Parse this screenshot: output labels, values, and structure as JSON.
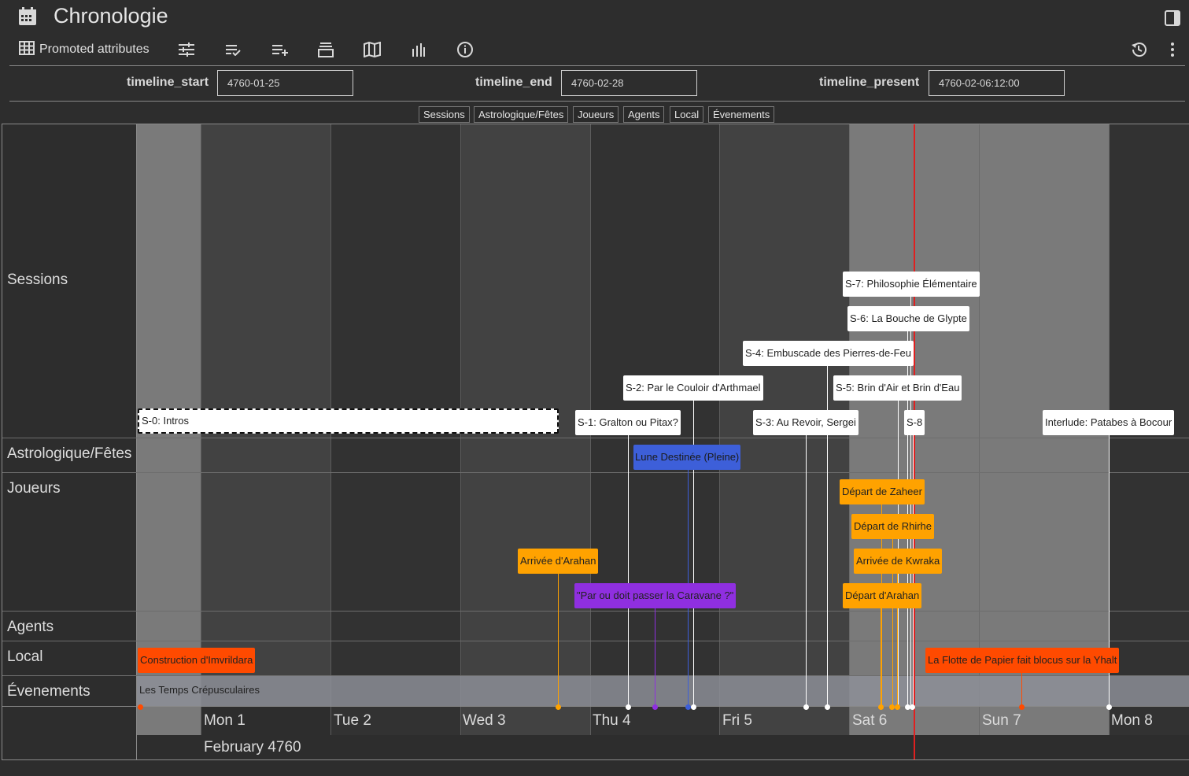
{
  "header": {
    "title": "Chronologie",
    "calendar_icon": "calendar-icon",
    "right_sidebar_icon": "sidebar-toggle-icon"
  },
  "toolbar": {
    "promoted_label": "Promoted attributes",
    "icons": [
      "grid-icon",
      "sliders-icon",
      "checklist-icon",
      "add-list-icon",
      "archive-icon",
      "map-icon",
      "chart-icon",
      "info-icon"
    ],
    "history_icon": "history-icon",
    "menu_icon": "more-vertical-icon"
  },
  "attributes": {
    "start_label": "timeline_start",
    "start_value": "4760-01-25",
    "end_label": "timeline_end",
    "end_value": "4760-02-28",
    "present_label": "timeline_present",
    "present_value": "4760-02-06:12:00"
  },
  "groups": [
    "Sessions",
    "Astrologique/Fêtes",
    "Joueurs",
    "Agents",
    "Local",
    "Évenements"
  ],
  "axis": {
    "days": [
      "Mon 1",
      "Tue 2",
      "Wed 3",
      "Thu 4",
      "Fri 5",
      "Sat 6",
      "Sun 7",
      "Mon 8"
    ],
    "month": "February 4760"
  },
  "colors": {
    "session": "#ffffff",
    "astro": "#3d5fd9",
    "player_orange": "#ffa200",
    "player_purple": "#8f2fe0",
    "local": "#ff4a00",
    "present_line": "#e02020",
    "event_band": "#8e9099"
  },
  "items": {
    "sessions": [
      {
        "label": "S-0: Intros"
      },
      {
        "label": "S-1: Gralton ou Pitax?"
      },
      {
        "label": "S-2: Par le Couloir d'Arthmael"
      },
      {
        "label": "S-3: Au Revoir, Sergei"
      },
      {
        "label": "S-4: Embuscade des Pierres-de-Feu"
      },
      {
        "label": "S-5: Brin d'Air et Brin d'Eau"
      },
      {
        "label": "S-6: La Bouche de Glypte"
      },
      {
        "label": "S-7: Philosophie Élémentaire"
      },
      {
        "label": "S-8"
      },
      {
        "label": "Interlude: Patabes à Bocour"
      }
    ],
    "astro": [
      {
        "label": "Lune Destinée (Pleine)"
      }
    ],
    "players": [
      {
        "label": "Arrivée d'Arahan"
      },
      {
        "label": "\"Par ou doit passer la Caravane ?\""
      },
      {
        "label": "Départ de Zaheer"
      },
      {
        "label": "Départ de Rhirhe"
      },
      {
        "label": "Arrivée de Kwraka"
      },
      {
        "label": "Départ d'Arahan"
      }
    ],
    "local": [
      {
        "label": "Construction d'Imvrildara"
      },
      {
        "label": "La Flotte de Papier fait blocus sur la Yhalt"
      }
    ],
    "events": [
      {
        "label": "Les Temps Crépusculaires"
      }
    ]
  }
}
